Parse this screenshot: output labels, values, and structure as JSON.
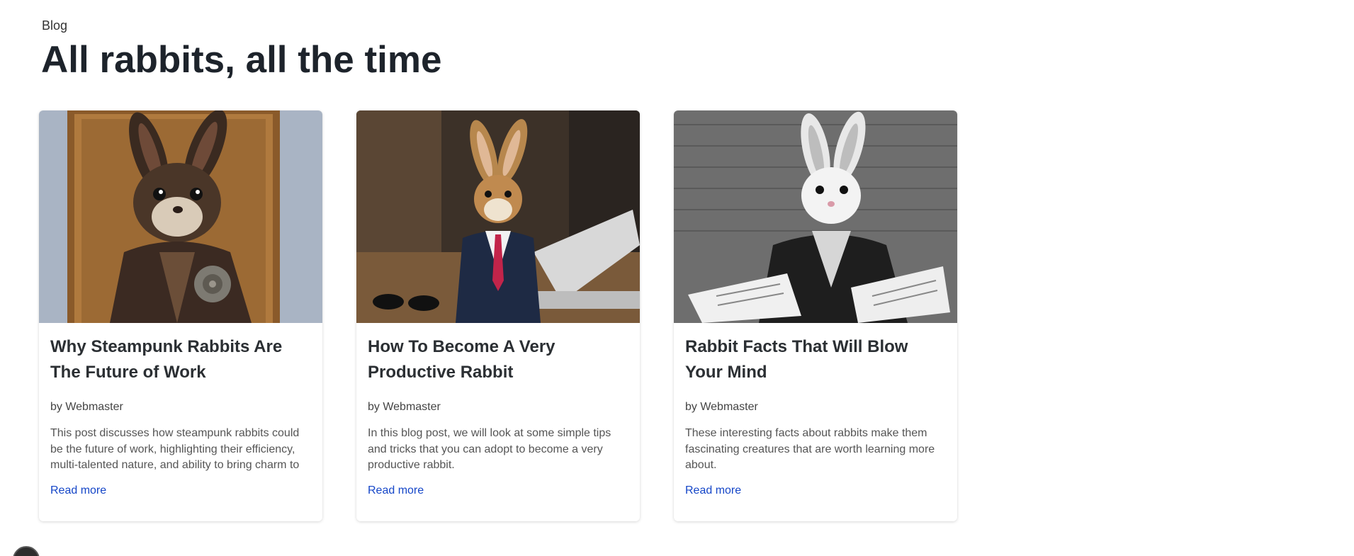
{
  "header": {
    "eyebrow": "Blog",
    "title": "All rabbits, all the time"
  },
  "posts": [
    {
      "image_icon": "steampunk-rabbit-image",
      "title": "Why Steampunk Rabbits Are The Future of Work",
      "author": "by Webmaster",
      "excerpt": "This post discusses how steampunk rabbits could be the future of work, highlighting their efficiency, multi-talented nature, and ability to bring charm to",
      "link": "Read more"
    },
    {
      "image_icon": "business-rabbit-image",
      "title": "How To Become A Very Productive Rabbit",
      "author": "by Webmaster",
      "excerpt": "In this blog post, we will look at some simple tips and tricks that you can adopt to become a very productive rabbit.",
      "link": "Read more"
    },
    {
      "image_icon": "writer-rabbit-image",
      "title": "Rabbit Facts That Will Blow Your Mind",
      "author": "by Webmaster",
      "excerpt": "These interesting facts about rabbits make them fascinating creatures that are worth learning more about.",
      "link": "Read more"
    }
  ],
  "colors": {
    "link": "#1546c8",
    "title": "#1d232b"
  },
  "corner_widget_icon": "dark-circle-icon"
}
